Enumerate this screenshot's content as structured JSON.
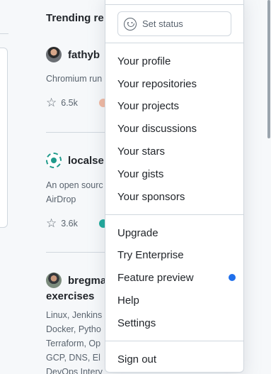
{
  "feed": {
    "title": "Trending re",
    "repos": [
      {
        "name": "fathyb",
        "description": "Chromium run",
        "stars": "6.5k"
      },
      {
        "name": "localse",
        "description_1": "An open sourc",
        "description_2": "AirDrop",
        "stars": "3.6k"
      },
      {
        "name": "bregma",
        "name_2": "exercises",
        "lines": [
          "Linux, Jenkins",
          "Docker, Pytho",
          "Terraform, Op",
          "GCP, DNS, El",
          "DevOps Interv"
        ]
      }
    ]
  },
  "menu": {
    "status_label": "Set status",
    "group1": [
      "Your profile",
      "Your repositories",
      "Your projects",
      "Your discussions",
      "Your stars",
      "Your gists",
      "Your sponsors"
    ],
    "group2": [
      "Upgrade",
      "Try Enterprise",
      "Feature preview",
      "Help",
      "Settings"
    ],
    "sign_out": "Sign out"
  },
  "colors": {
    "accent_dot": "#1f6feb",
    "lang_dot_1": "#f1b7a0",
    "lang_dot_2": "#19a89a"
  }
}
